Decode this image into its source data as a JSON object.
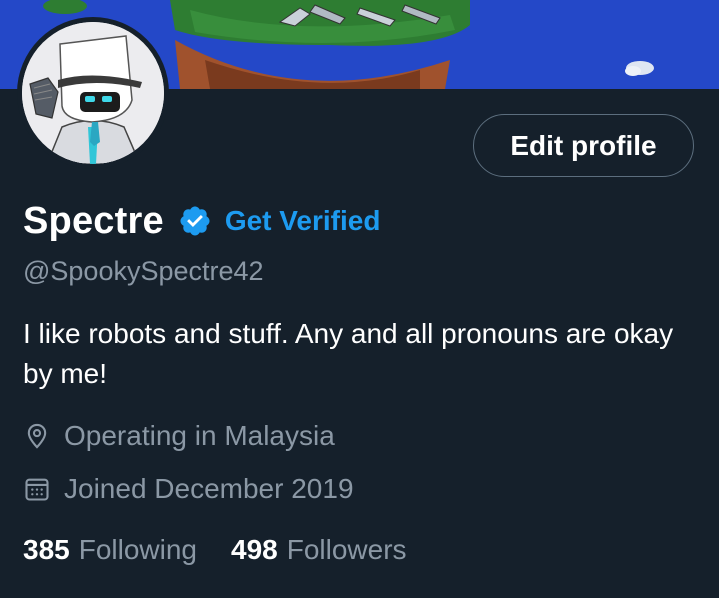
{
  "profile": {
    "display_name": "Spectre",
    "verified_icon": "verified-badge-icon",
    "get_verified_label": "Get Verified",
    "handle": "@SpookySpectre42",
    "bio": "I like robots and stuff. Any and all pronouns are okay by me!",
    "location": "Operating in Malaysia",
    "joined": "Joined December 2019",
    "following_count": "385",
    "following_label": "Following",
    "followers_count": "498",
    "followers_label": "Followers"
  },
  "actions": {
    "edit_profile_label": "Edit profile"
  },
  "colors": {
    "background": "#15202b",
    "accent": "#1d9bf0",
    "secondary_text": "#8b98a5",
    "button_border": "#5c6e7e"
  }
}
